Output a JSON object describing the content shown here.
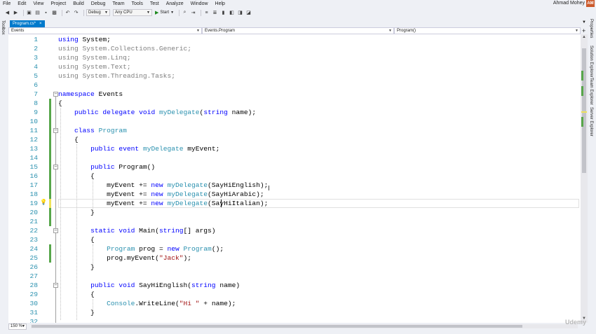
{
  "menu": [
    "File",
    "Edit",
    "View",
    "Project",
    "Build",
    "Debug",
    "Team",
    "Tools",
    "Test",
    "Analyze",
    "Window",
    "Help"
  ],
  "user": {
    "name": "Ahmad Mohey",
    "initials": "AM"
  },
  "toolbar": {
    "config": "Debug",
    "platform": "Any CPU",
    "start_label": "Start"
  },
  "sidebars": {
    "left": "Toolbox",
    "right": [
      "Properties",
      "Solution Explorer",
      "Team Explorer",
      "Server Explorer"
    ]
  },
  "tab": {
    "label": "Program.cs*",
    "close": "×"
  },
  "nav": {
    "project": "Events",
    "type": "Events.Program",
    "member": "Program()"
  },
  "zoom": "150 %",
  "watermark": "Udemy",
  "colors": {
    "accent": "#007acc",
    "keyword": "#0000ff",
    "type": "#2b91af",
    "string": "#a31515",
    "changed": "#57a64a",
    "unsaved": "#efe25a"
  },
  "code_lines": [
    {
      "n": "1",
      "tokens": [
        {
          "k": "kw",
          "t": "using"
        },
        {
          "t": " System;"
        }
      ]
    },
    {
      "n": "2",
      "tokens": [
        {
          "k": "gr",
          "t": "using System.Collections.Generic;"
        }
      ]
    },
    {
      "n": "3",
      "tokens": [
        {
          "k": "gr",
          "t": "using System.Linq;"
        }
      ]
    },
    {
      "n": "4",
      "tokens": [
        {
          "k": "gr",
          "t": "using System.Text;"
        }
      ]
    },
    {
      "n": "5",
      "tokens": [
        {
          "k": "gr",
          "t": "using System.Threading.Tasks;"
        }
      ]
    },
    {
      "n": "6",
      "tokens": []
    },
    {
      "n": "7",
      "tokens": [
        {
          "k": "kw",
          "t": "namespace"
        },
        {
          "t": " Events"
        }
      ]
    },
    {
      "n": "8",
      "tokens": [
        {
          "t": "{"
        }
      ]
    },
    {
      "n": "9",
      "tokens": [
        {
          "t": "    "
        },
        {
          "k": "kw",
          "t": "public"
        },
        {
          "t": " "
        },
        {
          "k": "kw",
          "t": "delegate"
        },
        {
          "t": " "
        },
        {
          "k": "kw",
          "t": "void"
        },
        {
          "t": " "
        },
        {
          "k": "ty",
          "t": "myDelegate"
        },
        {
          "t": "("
        },
        {
          "k": "kw",
          "t": "string"
        },
        {
          "t": " name);"
        }
      ]
    },
    {
      "n": "10",
      "tokens": []
    },
    {
      "n": "11",
      "tokens": [
        {
          "t": "    "
        },
        {
          "k": "kw",
          "t": "class"
        },
        {
          "t": " "
        },
        {
          "k": "ty",
          "t": "Program"
        }
      ]
    },
    {
      "n": "12",
      "tokens": [
        {
          "t": "    {"
        }
      ]
    },
    {
      "n": "13",
      "tokens": [
        {
          "t": "        "
        },
        {
          "k": "kw",
          "t": "public"
        },
        {
          "t": " "
        },
        {
          "k": "kw",
          "t": "event"
        },
        {
          "t": " "
        },
        {
          "k": "ty",
          "t": "myDelegate"
        },
        {
          "t": " myEvent;"
        }
      ]
    },
    {
      "n": "14",
      "tokens": []
    },
    {
      "n": "15",
      "tokens": [
        {
          "t": "        "
        },
        {
          "k": "kw",
          "t": "public"
        },
        {
          "t": " Program()"
        }
      ]
    },
    {
      "n": "16",
      "tokens": [
        {
          "t": "        {"
        }
      ]
    },
    {
      "n": "17",
      "tokens": [
        {
          "t": "            myEvent += "
        },
        {
          "k": "kw",
          "t": "new"
        },
        {
          "t": " "
        },
        {
          "k": "ty",
          "t": "myDelegate"
        },
        {
          "t": "(SayHiEnglish);"
        }
      ]
    },
    {
      "n": "18",
      "tokens": [
        {
          "t": "            myEvent += "
        },
        {
          "k": "kw",
          "t": "new"
        },
        {
          "t": " "
        },
        {
          "k": "ty",
          "t": "myDelegate"
        },
        {
          "t": "(SayHiArabic);"
        }
      ]
    },
    {
      "n": "19",
      "tokens": [
        {
          "t": "            myEvent += "
        },
        {
          "k": "kw",
          "t": "new"
        },
        {
          "t": " "
        },
        {
          "k": "ty",
          "t": "myDelegate"
        },
        {
          "t": "(SayHiItalian);"
        }
      ]
    },
    {
      "n": "20",
      "tokens": [
        {
          "t": "        }"
        }
      ]
    },
    {
      "n": "21",
      "tokens": []
    },
    {
      "n": "22",
      "tokens": [
        {
          "t": "        "
        },
        {
          "k": "kw",
          "t": "static"
        },
        {
          "t": " "
        },
        {
          "k": "kw",
          "t": "void"
        },
        {
          "t": " Main("
        },
        {
          "k": "kw",
          "t": "string"
        },
        {
          "t": "[] args)"
        }
      ]
    },
    {
      "n": "23",
      "tokens": [
        {
          "t": "        {"
        }
      ]
    },
    {
      "n": "24",
      "tokens": [
        {
          "t": "            "
        },
        {
          "k": "ty",
          "t": "Program"
        },
        {
          "t": " prog = "
        },
        {
          "k": "kw",
          "t": "new"
        },
        {
          "t": " "
        },
        {
          "k": "ty",
          "t": "Program"
        },
        {
          "t": "();"
        }
      ]
    },
    {
      "n": "25",
      "tokens": [
        {
          "t": "            prog.myEvent("
        },
        {
          "k": "st",
          "t": "\"Jack\""
        },
        {
          "t": ");"
        }
      ]
    },
    {
      "n": "26",
      "tokens": [
        {
          "t": "        }"
        }
      ]
    },
    {
      "n": "27",
      "tokens": []
    },
    {
      "n": "28",
      "tokens": [
        {
          "t": "        "
        },
        {
          "k": "kw",
          "t": "public"
        },
        {
          "t": " "
        },
        {
          "k": "kw",
          "t": "void"
        },
        {
          "t": " SayHiEnglish("
        },
        {
          "k": "kw",
          "t": "string"
        },
        {
          "t": " name)"
        }
      ]
    },
    {
      "n": "29",
      "tokens": [
        {
          "t": "        {"
        }
      ]
    },
    {
      "n": "30",
      "tokens": [
        {
          "t": "            "
        },
        {
          "k": "ty",
          "t": "Console"
        },
        {
          "t": ".WriteLine("
        },
        {
          "k": "st",
          "t": "\"Hi \""
        },
        {
          "t": " + name);"
        }
      ]
    },
    {
      "n": "31",
      "tokens": [
        {
          "t": "        }"
        }
      ]
    },
    {
      "n": "32",
      "tokens": []
    }
  ]
}
